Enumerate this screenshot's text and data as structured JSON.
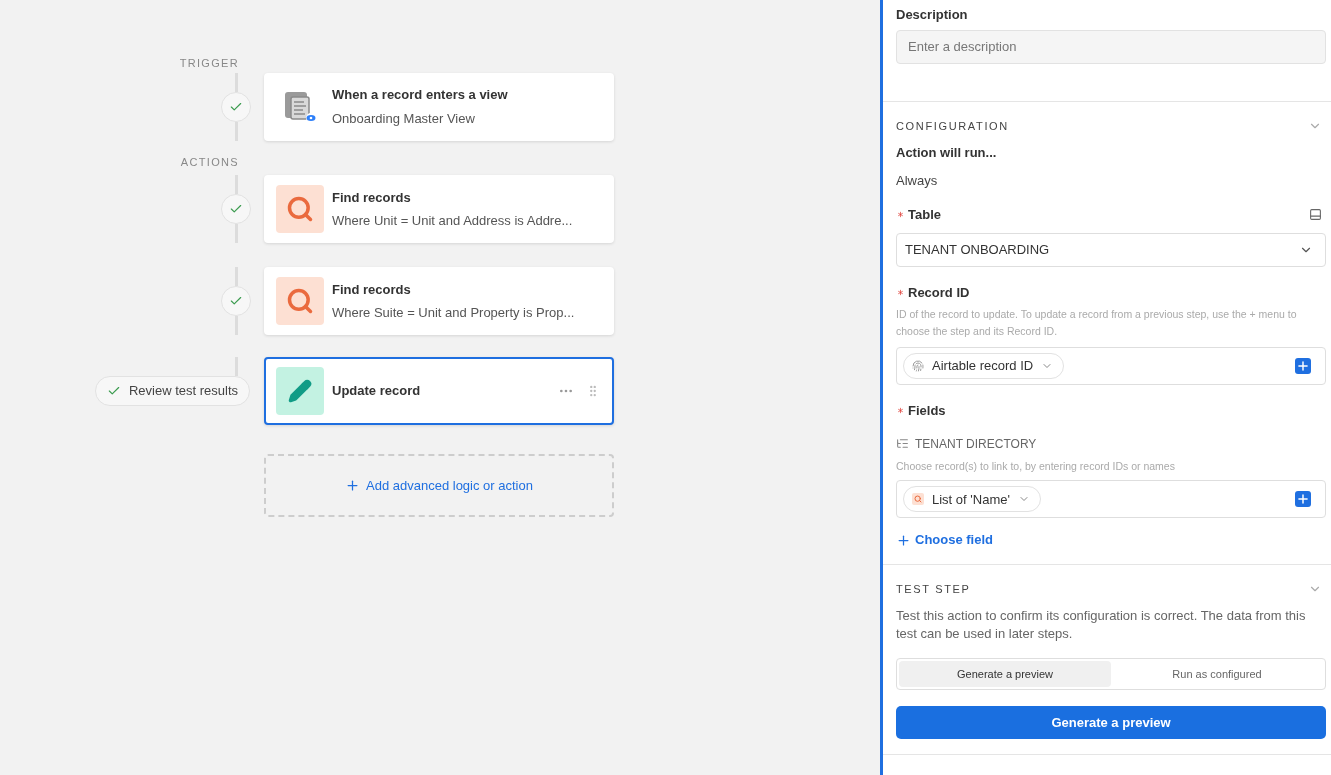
{
  "flow": {
    "trigger_label": "TRIGGER",
    "actions_label": "ACTIONS",
    "steps": [
      {
        "kind": "trigger",
        "title": "When a record enters a view",
        "subtitle": "Onboarding Master View",
        "checked": true,
        "selected": false
      },
      {
        "kind": "find",
        "title": "Find records",
        "subtitle": "Where Unit = Unit and Address is Addre...",
        "checked": true,
        "selected": false
      },
      {
        "kind": "find",
        "title": "Find records",
        "subtitle": "Where Suite = Unit and Property is Prop...",
        "checked": true,
        "selected": false
      },
      {
        "kind": "update",
        "title": "Update record",
        "checked": true,
        "review_label": "Review test results",
        "selected": true
      }
    ],
    "add_label": "Add advanced logic or action"
  },
  "panel": {
    "description": {
      "label": "Description",
      "placeholder": "Enter a description"
    },
    "configuration": {
      "title": "CONFIGURATION",
      "expanded": true,
      "run_label": "Action will run...",
      "run_value": "Always",
      "table": {
        "label": "Table",
        "required": true,
        "value": "TENANT ONBOARDING"
      },
      "record_id": {
        "label": "Record ID",
        "required": true,
        "help": "ID of the record to update. To update a record from a previous step, use the + menu to choose the step and its Record ID.",
        "token": "Airtable record ID"
      },
      "fields": {
        "label": "Fields",
        "required": true,
        "items": [
          {
            "name": "TENANT DIRECTORY",
            "help": "Choose record(s) to link to, by entering record IDs or names",
            "token": "List of 'Name'"
          }
        ]
      },
      "choose_field": "Choose field"
    },
    "test_step": {
      "title": "TEST STEP",
      "expanded": true,
      "description": "Test this action to confirm its configuration is correct. The data from this test can be used in later steps.",
      "modes": [
        {
          "label": "Generate a preview",
          "selected": true
        },
        {
          "label": "Run as configured",
          "selected": false
        }
      ],
      "button": "Generate a preview"
    }
  }
}
